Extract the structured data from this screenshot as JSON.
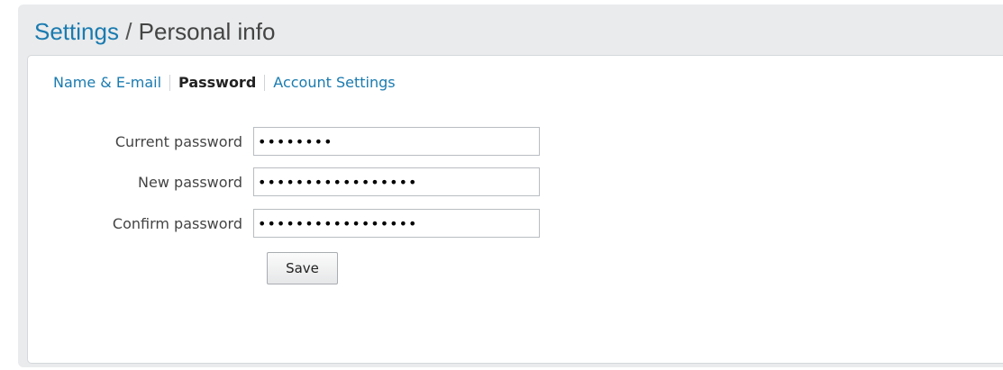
{
  "header": {
    "breadcrumb_root": "Settings",
    "separator": "/",
    "current": "Personal info"
  },
  "subnav": {
    "items": [
      {
        "label": "Name & E-mail",
        "active": false
      },
      {
        "label": "Password",
        "active": true
      },
      {
        "label": "Account Settings",
        "active": false
      }
    ]
  },
  "form": {
    "current_password": {
      "label": "Current password",
      "value": "12345678"
    },
    "new_password": {
      "label": "New password",
      "value": "1234567890abcdefg"
    },
    "confirm_password": {
      "label": "Confirm password",
      "value": "1234567890abcdefg"
    },
    "save_label": "Save"
  },
  "colors": {
    "link": "#1a7bb0",
    "outer_background": "#e9ebec",
    "panel_background": "#ffffff"
  }
}
